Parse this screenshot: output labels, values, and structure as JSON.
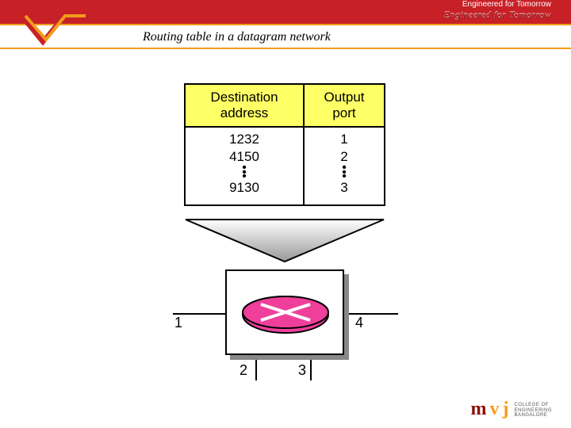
{
  "banner": {
    "line1": "Engineered for Tomorrow",
    "line2": "Engineered for Tomorrow"
  },
  "title": "Routing table in a datagram network",
  "table": {
    "head_dest": "Destination address",
    "head_port": "Output port",
    "dest_1": "1232",
    "dest_2": "4150",
    "dest_last": "9130",
    "port_1": "1",
    "port_2": "2",
    "port_last": "3"
  },
  "ports": {
    "p1": "1",
    "p2": "2",
    "p3": "3",
    "p4": "4"
  },
  "brand": {
    "m": "m",
    "v": "v",
    "j": "j",
    "t1": "COLLEGE OF",
    "t2": "ENGINEERING",
    "t3": "BANGALORE"
  }
}
